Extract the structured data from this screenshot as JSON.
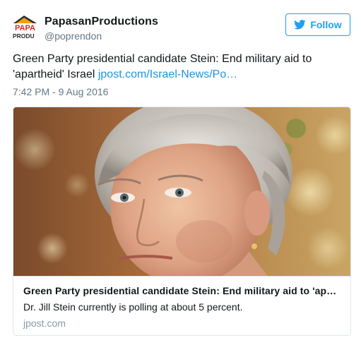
{
  "user": {
    "display_name": "PapasanProductions",
    "handle": "@poprendon",
    "avatar_icon": "papasan-logo",
    "avatar_text_top": "PAPA",
    "avatar_text_bottom": "PRODU"
  },
  "follow_button": {
    "label": "Follow",
    "icon": "twitter-bird-icon",
    "color": "#1da1f2"
  },
  "tweet": {
    "text": "Green Party presidential candidate Stein: End military aid to 'apartheid' Israel ",
    "link_text": "jpost.com/Israel-News/Po…",
    "timestamp": "7:42 PM - 9 Aug 2016"
  },
  "card": {
    "image_subject": "photo-of-woman-with-gray-hair",
    "title": "Green Party presidential candidate Stein: End military aid to 'ap…",
    "description": "Dr. Jill Stein currently is polling at about 5 percent.",
    "domain": "jpost.com"
  },
  "colors": {
    "link": "#1b95e0",
    "text": "#14171a",
    "muted": "#657786",
    "border": "#e1e8ed"
  }
}
